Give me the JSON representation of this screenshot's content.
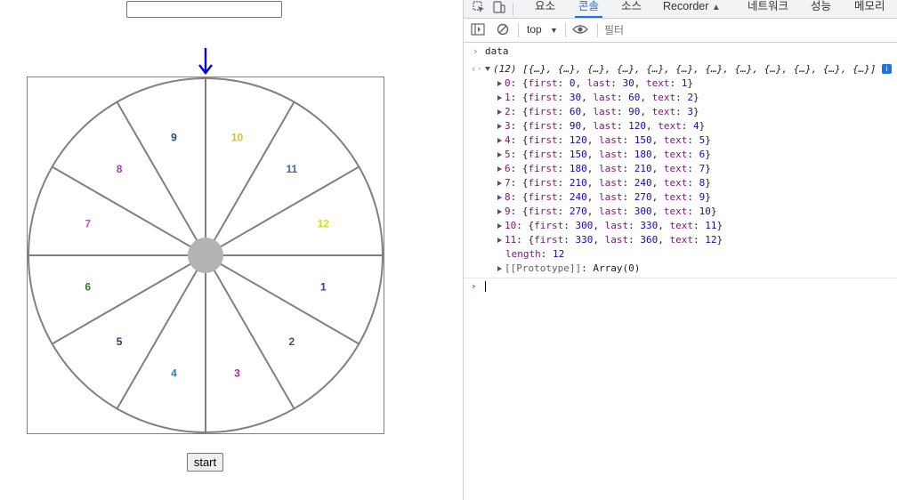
{
  "app": {
    "input_value": "",
    "start_label": "start",
    "pointer_color": "#0000dd"
  },
  "wheel": {
    "segments": [
      {
        "text": "1",
        "color": "#1a3fd8"
      },
      {
        "text": "2",
        "color": "#2f5580"
      },
      {
        "text": "3",
        "color": "#a32aad"
      },
      {
        "text": "4",
        "color": "#2e7bcf"
      },
      {
        "text": "5",
        "color": "#233a6e"
      },
      {
        "text": "6",
        "color": "#2c7a2c"
      },
      {
        "text": "7",
        "color": "#d04ad0"
      },
      {
        "text": "8",
        "color": "#9b3bc9"
      },
      {
        "text": "9",
        "color": "#1f4a78"
      },
      {
        "text": "10",
        "color": "#d6c21c"
      },
      {
        "text": "11",
        "color": "#3a6f8f"
      },
      {
        "text": "12",
        "color": "#c9e41b"
      }
    ],
    "line_color": "#808080",
    "hub_color": "#b3b3b3"
  },
  "devtools": {
    "tabs": [
      "요소",
      "콘솔",
      "소스",
      "Recorder",
      "네트워크",
      "성능",
      "메모리"
    ],
    "active_tab": "콘솔",
    "context": "top",
    "filter_placeholder": "필터",
    "command": "data",
    "array_length_label": "(12)",
    "array_preview": "[{…}, {…}, {…}, {…}, {…}, {…}, {…}, {…}, {…}, {…}, {…}, {…}]",
    "entries": [
      {
        "index": "0",
        "first": "0",
        "last": "30",
        "text": "1"
      },
      {
        "index": "1",
        "first": "30",
        "last": "60",
        "text": "2"
      },
      {
        "index": "2",
        "first": "60",
        "last": "90",
        "text": "3"
      },
      {
        "index": "3",
        "first": "90",
        "last": "120",
        "text": "4"
      },
      {
        "index": "4",
        "first": "120",
        "last": "150",
        "text": "5"
      },
      {
        "index": "5",
        "first": "150",
        "last": "180",
        "text": "6"
      },
      {
        "index": "6",
        "first": "180",
        "last": "210",
        "text": "7"
      },
      {
        "index": "7",
        "first": "210",
        "last": "240",
        "text": "8"
      },
      {
        "index": "8",
        "first": "240",
        "last": "270",
        "text": "9"
      },
      {
        "index": "9",
        "first": "270",
        "last": "300",
        "text": "10"
      },
      {
        "index": "10",
        "first": "300",
        "last": "330",
        "text": "11"
      },
      {
        "index": "11",
        "first": "330",
        "last": "360",
        "text": "12"
      }
    ],
    "length_key": "length",
    "length_value": "12",
    "prototype_label": "[[Prototype]]",
    "prototype_value": "Array(0)"
  }
}
